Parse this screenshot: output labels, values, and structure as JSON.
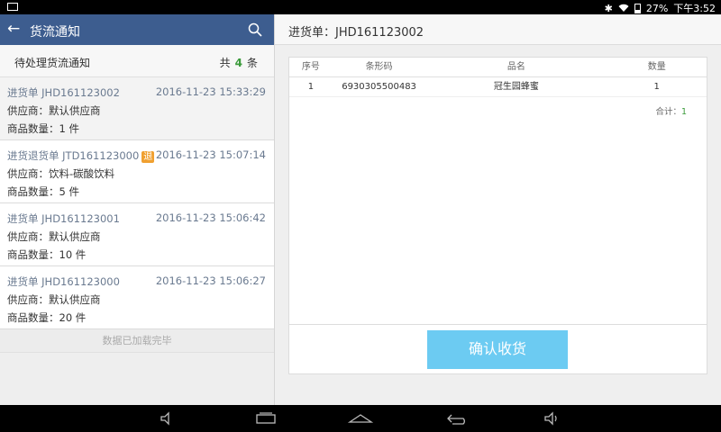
{
  "statusbar": {
    "battery": "27%",
    "time": "下午3:52"
  },
  "left": {
    "title": "货流通知",
    "pending_label": "待处理货流通知",
    "count_prefix": "共",
    "count": "4",
    "count_suffix": "条",
    "notices": [
      {
        "order": "进货单 JHD161123002",
        "badge": "",
        "time": "2016-11-23 15:33:29",
        "supplier": "供应商：默认供应商",
        "qty": "商品数量：1 件"
      },
      {
        "order": "进货退货单 JTD161123000",
        "badge": "退",
        "time": "2016-11-23 15:07:14",
        "supplier": "供应商：饮料-碳酸饮料",
        "qty": "商品数量：5 件"
      },
      {
        "order": "进货单 JHD161123001",
        "badge": "",
        "time": "2016-11-23 15:06:42",
        "supplier": "供应商：默认供应商",
        "qty": "商品数量：10 件"
      },
      {
        "order": "进货单 JHD161123000",
        "badge": "",
        "time": "2016-11-23 15:06:27",
        "supplier": "供应商：默认供应商",
        "qty": "商品数量：20 件"
      }
    ],
    "loaded_tip": "数据已加载完毕"
  },
  "right": {
    "title": "进货单：JHD161123002",
    "columns": {
      "no": "序号",
      "barcode": "条形码",
      "name": "品名",
      "qty": "数量"
    },
    "rows": [
      {
        "no": "1",
        "barcode": "6930305500483",
        "name": "冠生园蜂蜜",
        "qty": "1"
      }
    ],
    "total_label": "合计：",
    "total_value": "1",
    "confirm_label": "确认收货"
  },
  "colors": {
    "header": "#3d5d8f",
    "confirm": "#6ccbf2",
    "count_green": "#3a9a3a",
    "badge": "#f0a030"
  }
}
